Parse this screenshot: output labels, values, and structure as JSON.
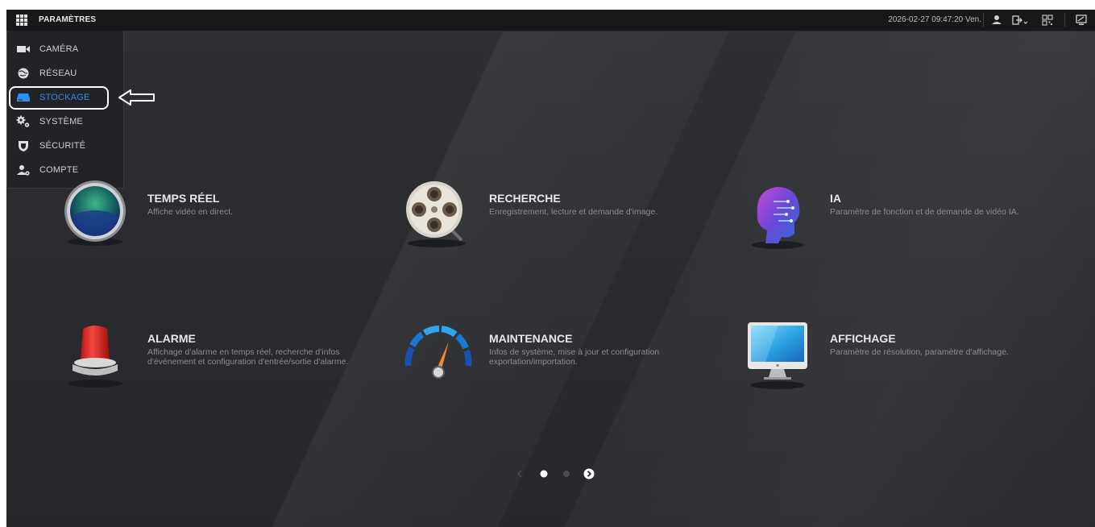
{
  "header": {
    "title": "PARAMÈTRES",
    "datetime": "2026-02-27 09:47:20 Ven.",
    "icons": [
      "grid-icon",
      "user-icon",
      "logout-icon",
      "qrcode-icon",
      "display-icon"
    ]
  },
  "menu": {
    "items": [
      {
        "label": "CAMÉRA",
        "icon": "camera-icon"
      },
      {
        "label": "RÉSEAU",
        "icon": "network-icon"
      },
      {
        "label": "STOCKAGE",
        "icon": "storage-icon",
        "active": true
      },
      {
        "label": "SYSTÈME",
        "icon": "system-gears-icon"
      },
      {
        "label": "SÉCURITÉ",
        "icon": "shield-icon"
      },
      {
        "label": "COMPTE",
        "icon": "account-icon"
      }
    ],
    "active_color": "#2e8fe8"
  },
  "tiles": [
    {
      "title": "TEMPS RÉEL",
      "desc": "Affiche vidéo en direct.",
      "icon": "live-view-icon"
    },
    {
      "title": "RECHERCHE",
      "desc": "Enregistrement, lecture et demande d'image.",
      "icon": "film-reel-icon"
    },
    {
      "title": "IA",
      "desc": "Paramètre de fonction et de demande de vidéo IA.",
      "icon": "ai-head-icon"
    },
    {
      "title": "ALARME",
      "desc": "Affichage d'alarme en temps réel, recherche d'infos d'événement et configuration d'entrée/sortie d'alarme.",
      "icon": "alarm-light-icon"
    },
    {
      "title": "MAINTENANCE",
      "desc": "Infos de système, mise à jour et configuration exportation/importation.",
      "icon": "gauge-icon"
    },
    {
      "title": "AFFICHAGE",
      "desc": "Paramètre de résolution, paramètre d'affichage.",
      "icon": "monitor-icon"
    }
  ],
  "pager": {
    "current_page": 1,
    "total_pages": 2
  }
}
